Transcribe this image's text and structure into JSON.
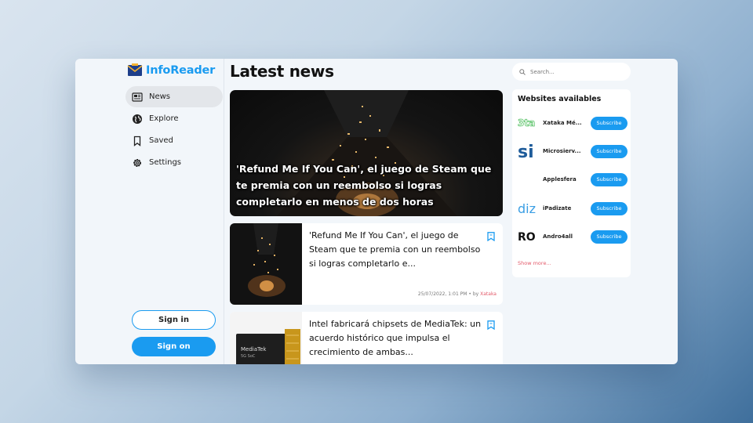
{
  "app": {
    "name": "InfoReader",
    "brand_color": "#1a9bf0",
    "accent_red": "#e35a6a"
  },
  "sidebar": {
    "items": [
      {
        "label": "News",
        "icon": "newspaper-icon",
        "active": true
      },
      {
        "label": "Explore",
        "icon": "globe-icon",
        "active": false
      },
      {
        "label": "Saved",
        "icon": "bookmark-icon",
        "active": false
      },
      {
        "label": "Settings",
        "icon": "gear-icon",
        "active": false
      }
    ],
    "sign_in": "Sign in",
    "sign_on": "Sign on"
  },
  "main": {
    "title": "Latest news",
    "hero": {
      "title": "'Refund Me If You Can', el juego de Steam que te premia con un reembolso si logras completarlo en menos de dos horas"
    },
    "articles": [
      {
        "title": "'Refund Me If You Can', el juego de Steam que te premia con un reembolso si logras completarlo e...",
        "date": "25/07/2022, 1:01 PM",
        "by": "• by",
        "source": "Xataka"
      },
      {
        "title": "Intel fabricará chipsets de MediaTek: un acuerdo histórico que impulsa el crecimiento de ambas..."
      }
    ]
  },
  "right": {
    "search": {
      "placeholder": "Search..."
    },
    "websites": {
      "title": "Websites availables",
      "items": [
        {
          "name": "Xataka Mé...",
          "logo": "xataka-logo-icon",
          "button": "Subscribe"
        },
        {
          "name": "Microsierv...",
          "logo": "si-logo-icon",
          "button": "Subscribe"
        },
        {
          "name": "Applesfera",
          "logo": "applesfera-logo-icon",
          "button": "Subscribe"
        },
        {
          "name": "iPadizate",
          "logo": "diz-logo-icon",
          "button": "Subscribe"
        },
        {
          "name": "Andro4all",
          "logo": "ro-logo-icon",
          "button": "Subscribe"
        }
      ],
      "show_more": "Show more..."
    }
  }
}
